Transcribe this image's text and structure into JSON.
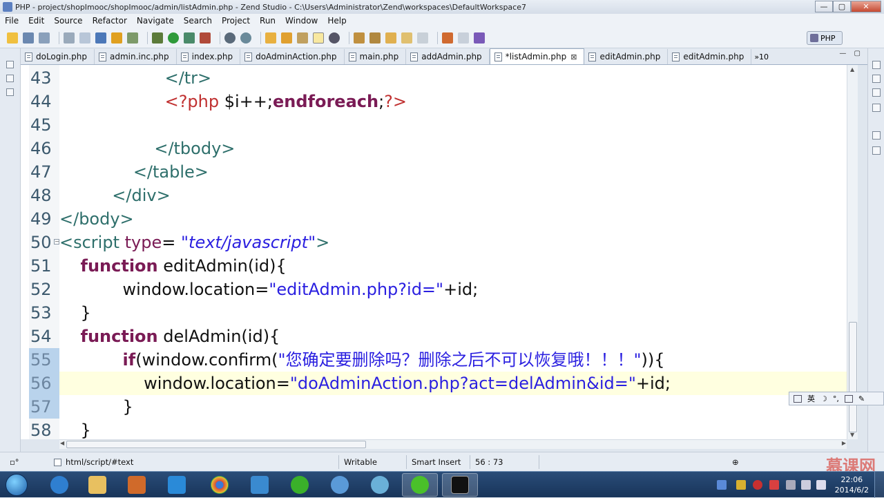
{
  "window": {
    "title": "PHP - project/shopImooc/shopImooc/admin/listAdmin.php - Zend Studio - C:\\Users\\Administrator\\Zend\\workspaces\\DefaultWorkspace7",
    "minimize": "—",
    "maximize": "▢",
    "close": "✕"
  },
  "menu": [
    "File",
    "Edit",
    "Source",
    "Refactor",
    "Navigate",
    "Search",
    "Project",
    "Run",
    "Window",
    "Help"
  ],
  "toolbar": {
    "perspective_label": "PHP"
  },
  "tabs": [
    {
      "label": "doLogin.php"
    },
    {
      "label": "admin.inc.php"
    },
    {
      "label": "index.php"
    },
    {
      "label": "doAdminAction.php"
    },
    {
      "label": "main.php"
    },
    {
      "label": "addAdmin.php"
    },
    {
      "label": "*listAdmin.php",
      "active": true,
      "close": "⊠"
    },
    {
      "label": "editAdmin.php"
    },
    {
      "label": "editAdmin.php"
    }
  ],
  "tab_overflow": "»10",
  "editor_controls": "— ▢",
  "code_lines": [
    {
      "num": "43",
      "tokens": [
        {
          "t": "                    ",
          "c": "plain"
        },
        {
          "t": "</tr>",
          "c": "tag"
        }
      ]
    },
    {
      "num": "44",
      "tokens": [
        {
          "t": "                    ",
          "c": "plain"
        },
        {
          "t": "<?php",
          "c": "php"
        },
        {
          "t": " $i++;",
          "c": "plain"
        },
        {
          "t": "endforeach",
          "c": "kw"
        },
        {
          "t": ";",
          "c": "plain"
        },
        {
          "t": "?>",
          "c": "php"
        }
      ]
    },
    {
      "num": "45",
      "tokens": [
        {
          "t": "",
          "c": "plain"
        }
      ]
    },
    {
      "num": "46",
      "tokens": [
        {
          "t": "                  ",
          "c": "plain"
        },
        {
          "t": "</tbody>",
          "c": "tag"
        }
      ]
    },
    {
      "num": "47",
      "tokens": [
        {
          "t": "              ",
          "c": "plain"
        },
        {
          "t": "</table>",
          "c": "tag"
        }
      ]
    },
    {
      "num": "48",
      "tokens": [
        {
          "t": "          ",
          "c": "plain"
        },
        {
          "t": "</div>",
          "c": "tag"
        }
      ]
    },
    {
      "num": "49",
      "tokens": [
        {
          "t": "</body>",
          "c": "tag"
        }
      ]
    },
    {
      "num": "50",
      "fold": "⊖",
      "tokens": [
        {
          "t": "<script ",
          "c": "tag"
        },
        {
          "t": "type",
          "c": "attr"
        },
        {
          "t": "= ",
          "c": "plain"
        },
        {
          "t": "\"text/javascript\"",
          "c": "stri"
        },
        {
          "t": ">",
          "c": "tag"
        }
      ]
    },
    {
      "num": "51",
      "tokens": [
        {
          "t": "    ",
          "c": "plain"
        },
        {
          "t": "function",
          "c": "kw"
        },
        {
          "t": " editAdmin(id){",
          "c": "plain"
        }
      ]
    },
    {
      "num": "52",
      "tokens": [
        {
          "t": "            window.location=",
          "c": "plain"
        },
        {
          "t": "\"editAdmin.php?id=\"",
          "c": "str"
        },
        {
          "t": "+id;",
          "c": "plain"
        }
      ]
    },
    {
      "num": "53",
      "tokens": [
        {
          "t": "    }",
          "c": "plain"
        }
      ]
    },
    {
      "num": "54",
      "tokens": [
        {
          "t": "    ",
          "c": "plain"
        },
        {
          "t": "function",
          "c": "kw"
        },
        {
          "t": " delAdmin(id){",
          "c": "plain"
        }
      ]
    },
    {
      "num": "55",
      "changed": true,
      "tokens": [
        {
          "t": "            ",
          "c": "plain"
        },
        {
          "t": "if",
          "c": "kw"
        },
        {
          "t": "(window.confirm(",
          "c": "plain"
        },
        {
          "t": "\"您确定要删除吗？删除之后不可以恢复哦！！！\"",
          "c": "str"
        },
        {
          "t": ")){",
          "c": "plain"
        }
      ]
    },
    {
      "num": "56",
      "changed": true,
      "current": true,
      "tokens": [
        {
          "t": "                window.location=",
          "c": "plain"
        },
        {
          "t": "\"doAdminAction.php?act=delAdmin&id=\"",
          "c": "str"
        },
        {
          "t": "+id;",
          "c": "plain"
        }
      ]
    },
    {
      "num": "57",
      "changed": true,
      "tokens": [
        {
          "t": "            }",
          "c": "plain"
        }
      ]
    },
    {
      "num": "58",
      "tokens": [
        {
          "t": "    }",
          "c": "plain"
        }
      ]
    }
  ],
  "ime": {
    "mode": "英"
  },
  "status": {
    "breadcrumb": "html/script/#text",
    "writable": "Writable",
    "insert_mode": "Smart Insert",
    "position": "56 : 73"
  },
  "watermark": "慕课网",
  "clock": {
    "time": "22:06",
    "date": "2014/6/2"
  },
  "colors": {
    "keyword": "#7a1b55",
    "string": "#2a1fe0",
    "tag": "#2e6f6b",
    "php": "#c03030",
    "current_line": "#ffffe0"
  }
}
